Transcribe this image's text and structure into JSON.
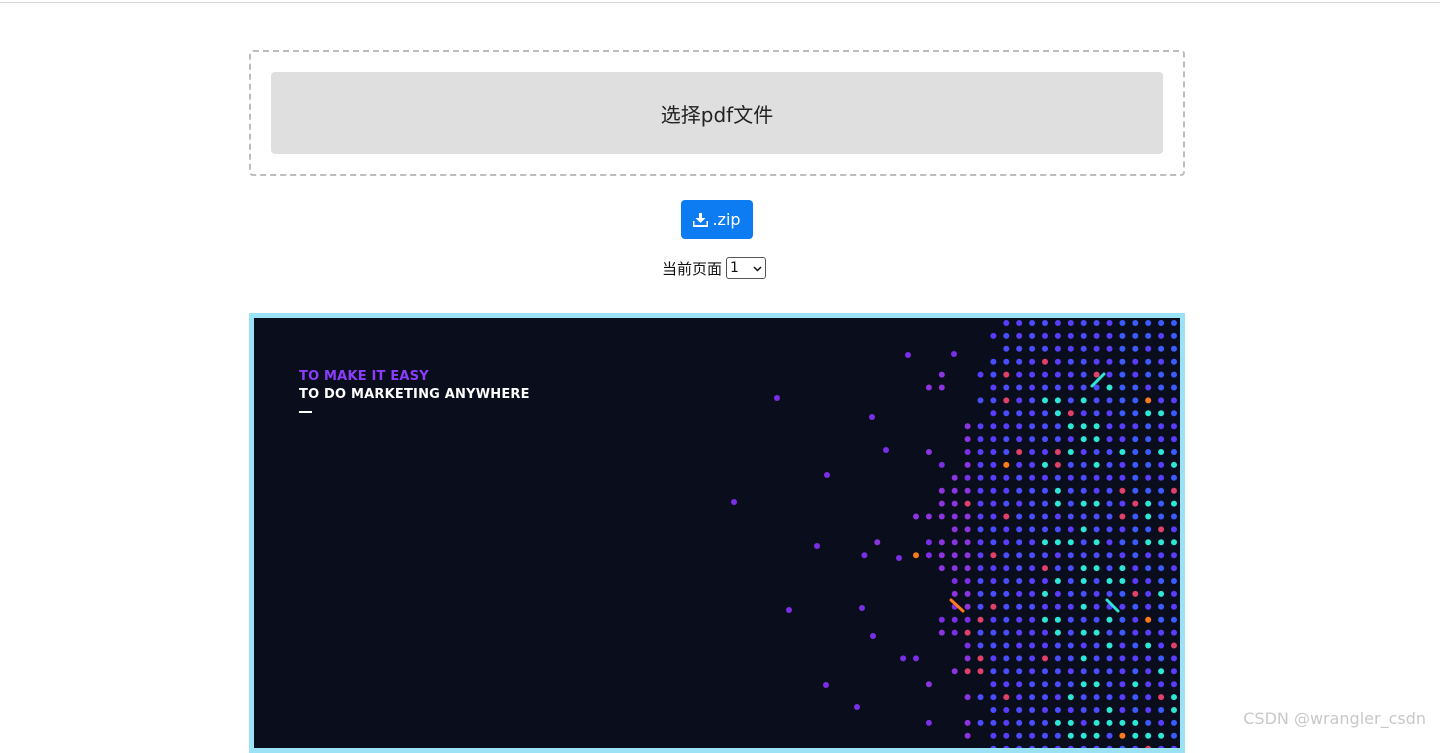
{
  "upload": {
    "choose_label": "选择pdf文件"
  },
  "download": {
    "zip_label": ".zip",
    "icon": "download-icon"
  },
  "pager": {
    "label": "当前页面",
    "selected": "1"
  },
  "preview": {
    "line1": "TO MAKE IT EASY",
    "line2": "TO DO MARKETING ANYWHERE"
  },
  "watermark": "CSDN @wrangler_csdn",
  "colors": {
    "button_blue": "#0d7cf2",
    "slide_bg": "#0a0e1c",
    "preview_border": "#9ce2f7",
    "accent_purple": "#8b3dff"
  }
}
